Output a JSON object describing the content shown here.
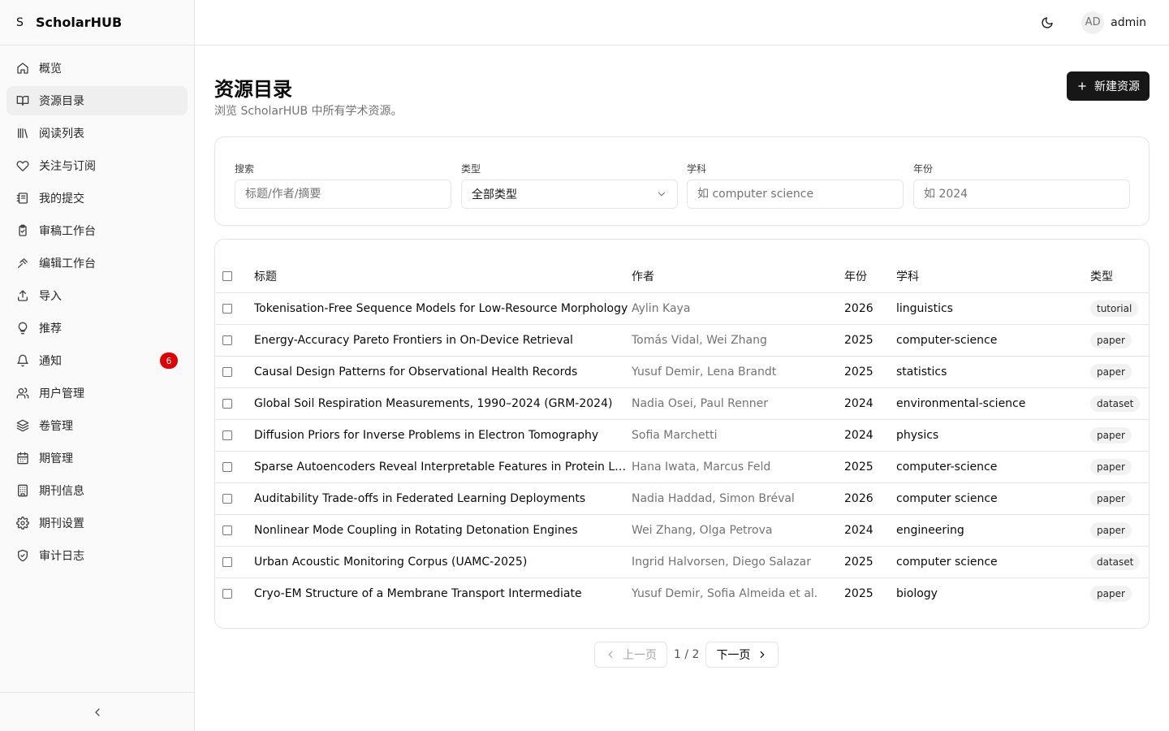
{
  "app": {
    "brand_mark": "S",
    "brand_name": "ScholarHUB"
  },
  "sidebar": {
    "items": [
      {
        "label": "概览",
        "icon": "home-icon"
      },
      {
        "label": "资源目录",
        "icon": "book-open-icon",
        "active": true
      },
      {
        "label": "阅读列表",
        "icon": "library-icon"
      },
      {
        "label": "关注与订阅",
        "icon": "heart-icon"
      },
      {
        "label": "我的提交",
        "icon": "notebook-icon"
      },
      {
        "label": "审稿工作台",
        "icon": "clipboard-check-icon"
      },
      {
        "label": "编辑工作台",
        "icon": "gavel-icon"
      },
      {
        "label": "导入",
        "icon": "upload-icon"
      },
      {
        "label": "推荐",
        "icon": "lightbulb-icon"
      },
      {
        "label": "通知",
        "icon": "bell-icon",
        "badge": "6"
      },
      {
        "label": "用户管理",
        "icon": "users-icon"
      },
      {
        "label": "卷管理",
        "icon": "layers-icon"
      },
      {
        "label": "期管理",
        "icon": "calendar-icon"
      },
      {
        "label": "期刊信息",
        "icon": "building-icon"
      },
      {
        "label": "期刊设置",
        "icon": "gear-icon"
      },
      {
        "label": "审计日志",
        "icon": "shield-check-icon"
      }
    ]
  },
  "header": {
    "avatar_initials": "AD",
    "username": "admin"
  },
  "page": {
    "title": "资源目录",
    "subtitle": "浏览 ScholarHUB 中所有学术资源。",
    "new_button": "新建资源"
  },
  "filters": {
    "search_label": "搜索",
    "search_placeholder": "标题/作者/摘要",
    "type_label": "类型",
    "type_value": "全部类型",
    "subject_label": "学科",
    "subject_placeholder": "如 computer science",
    "year_label": "年份",
    "year_placeholder": "如 2024"
  },
  "table": {
    "columns": {
      "title": "标题",
      "author": "作者",
      "year": "年份",
      "subject": "学科",
      "type": "类型"
    },
    "rows": [
      {
        "title": "Tokenisation-Free Sequence Models for Low-Resource Morphology",
        "author": "Aylin Kaya",
        "year": "2026",
        "subject": "linguistics",
        "type": "tutorial"
      },
      {
        "title": "Energy-Accuracy Pareto Frontiers in On-Device Retrieval",
        "author": "Tomás Vidal, Wei Zhang",
        "year": "2025",
        "subject": "computer-science",
        "type": "paper"
      },
      {
        "title": "Causal Design Patterns for Observational Health Records",
        "author": "Yusuf Demir, Lena Brandt",
        "year": "2025",
        "subject": "statistics",
        "type": "paper"
      },
      {
        "title": "Global Soil Respiration Measurements, 1990–2024 (GRM-2024)",
        "author": "Nadia Osei, Paul Renner",
        "year": "2024",
        "subject": "environmental-science",
        "type": "dataset"
      },
      {
        "title": "Diffusion Priors for Inverse Problems in Electron Tomography",
        "author": "Sofia Marchetti",
        "year": "2024",
        "subject": "physics",
        "type": "paper"
      },
      {
        "title": "Sparse Autoencoders Reveal Interpretable Features in Protein Lan...",
        "author": "Hana Iwata, Marcus Feld",
        "year": "2025",
        "subject": "computer-science",
        "type": "paper"
      },
      {
        "title": "Auditability Trade-offs in Federated Learning Deployments",
        "author": "Nadia Haddad, Simon Bréval",
        "year": "2026",
        "subject": "computer science",
        "type": "paper"
      },
      {
        "title": "Nonlinear Mode Coupling in Rotating Detonation Engines",
        "author": "Wei Zhang, Olga Petrova",
        "year": "2024",
        "subject": "engineering",
        "type": "paper"
      },
      {
        "title": "Urban Acoustic Monitoring Corpus (UAMC-2025)",
        "author": "Ingrid Halvorsen, Diego Salazar",
        "year": "2025",
        "subject": "computer science",
        "type": "dataset"
      },
      {
        "title": "Cryo-EM Structure of a Membrane Transport Intermediate",
        "author": "Yusuf Demir, Sofia Almeida et al.",
        "year": "2025",
        "subject": "biology",
        "type": "paper"
      }
    ]
  },
  "pagination": {
    "prev": "上一页",
    "info": "1 / 2",
    "next": "下一页"
  },
  "colors": {
    "accent": "#171717",
    "badge": "#e00000",
    "muted_text": "#737373",
    "border": "#e5e5e5"
  }
}
